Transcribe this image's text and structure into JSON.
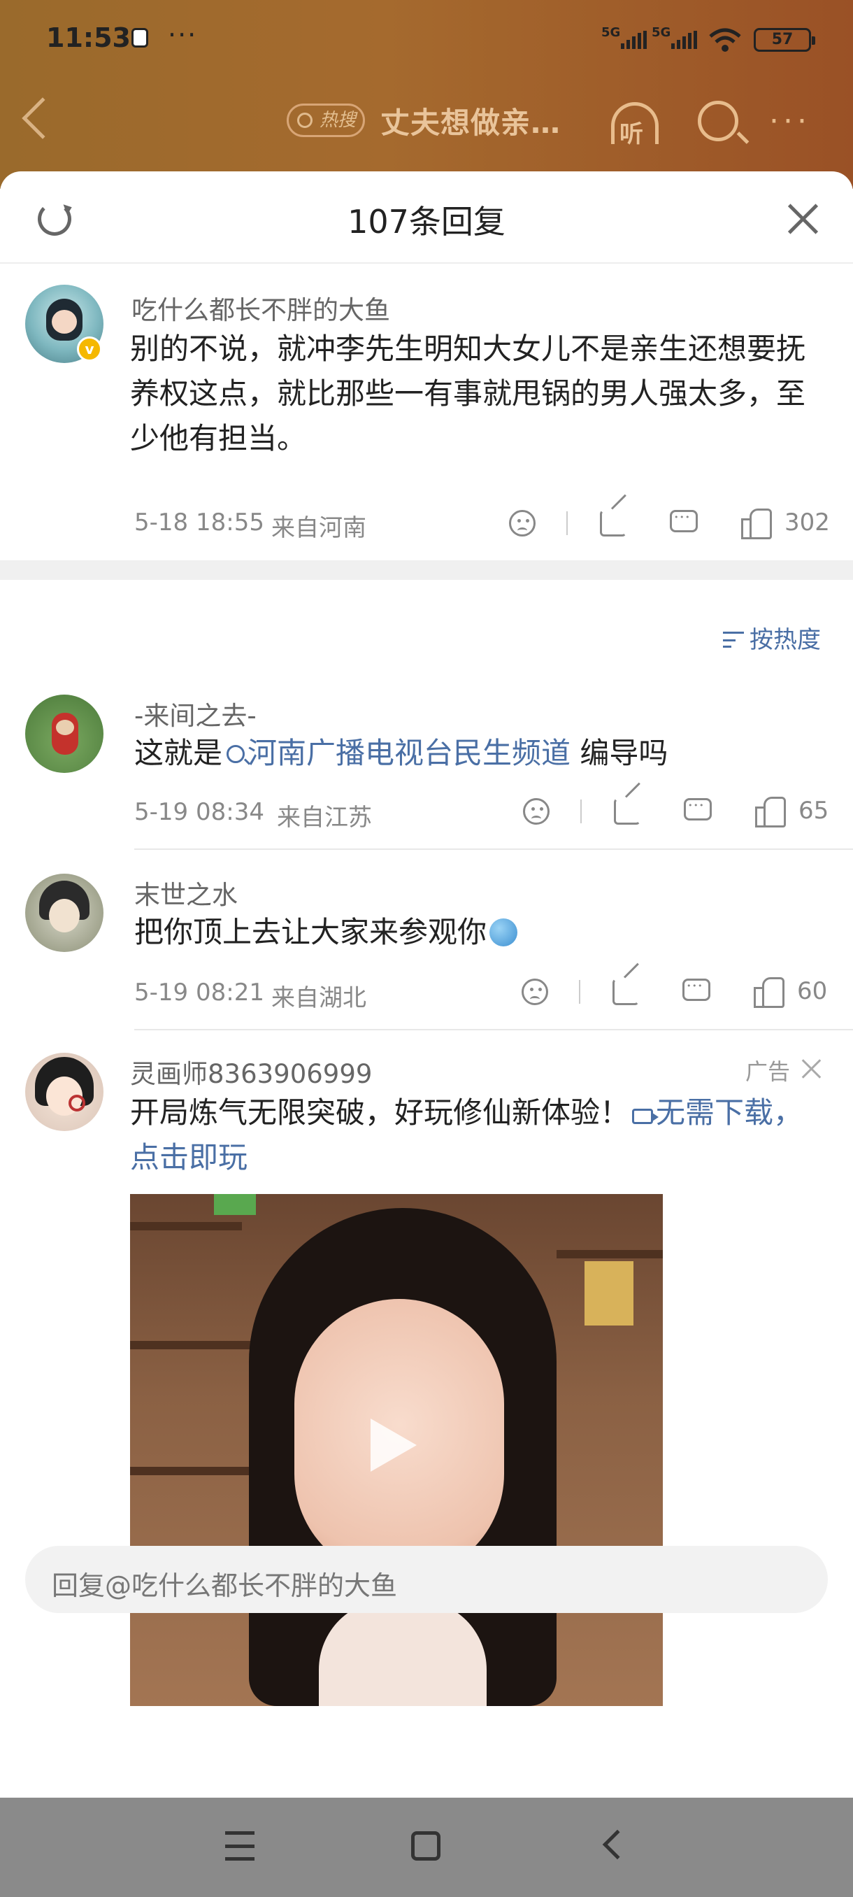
{
  "status_bar": {
    "time": "11:53",
    "more": "···",
    "signal1": "5G",
    "signal2": "5G",
    "battery": "57"
  },
  "nav": {
    "hot_badge": "热搜",
    "title": "丈夫想做亲…",
    "listen": "听"
  },
  "sheet": {
    "title": "107条回复"
  },
  "main_comment": {
    "username": "吃什么都长不胖的大鱼",
    "text": "别的不说，就冲李先生明知大女儿不是亲生还想要抚养权这点，就比那些一有事就甩锅的男人强太多，至少他有担当。",
    "date": "5-18 18:55",
    "location": "来自河南",
    "likes": "302"
  },
  "sort_label": "按热度",
  "replies": [
    {
      "username": "-来间之去-",
      "text_before": "这就是",
      "link": "河南广播电视台民生频道",
      "text_after": " 编导吗",
      "date": "5-19 08:34",
      "location": "来自江苏",
      "likes": "65"
    },
    {
      "username": "末世之水",
      "text": "把你顶上去让大家来参观你",
      "date": "5-19 08:21",
      "location": "来自湖北",
      "likes": "60"
    }
  ],
  "ad": {
    "username": "灵画师8363906999",
    "tag": "广告",
    "text": "开局炼气无限突破，好玩修仙新体验！",
    "link": "无需下载，点击即玩"
  },
  "reply_input": {
    "placeholder": "回复@吃什么都长不胖的大鱼"
  },
  "colors": {
    "link": "#4a6fa5",
    "header_bg": "#a56a2e"
  }
}
